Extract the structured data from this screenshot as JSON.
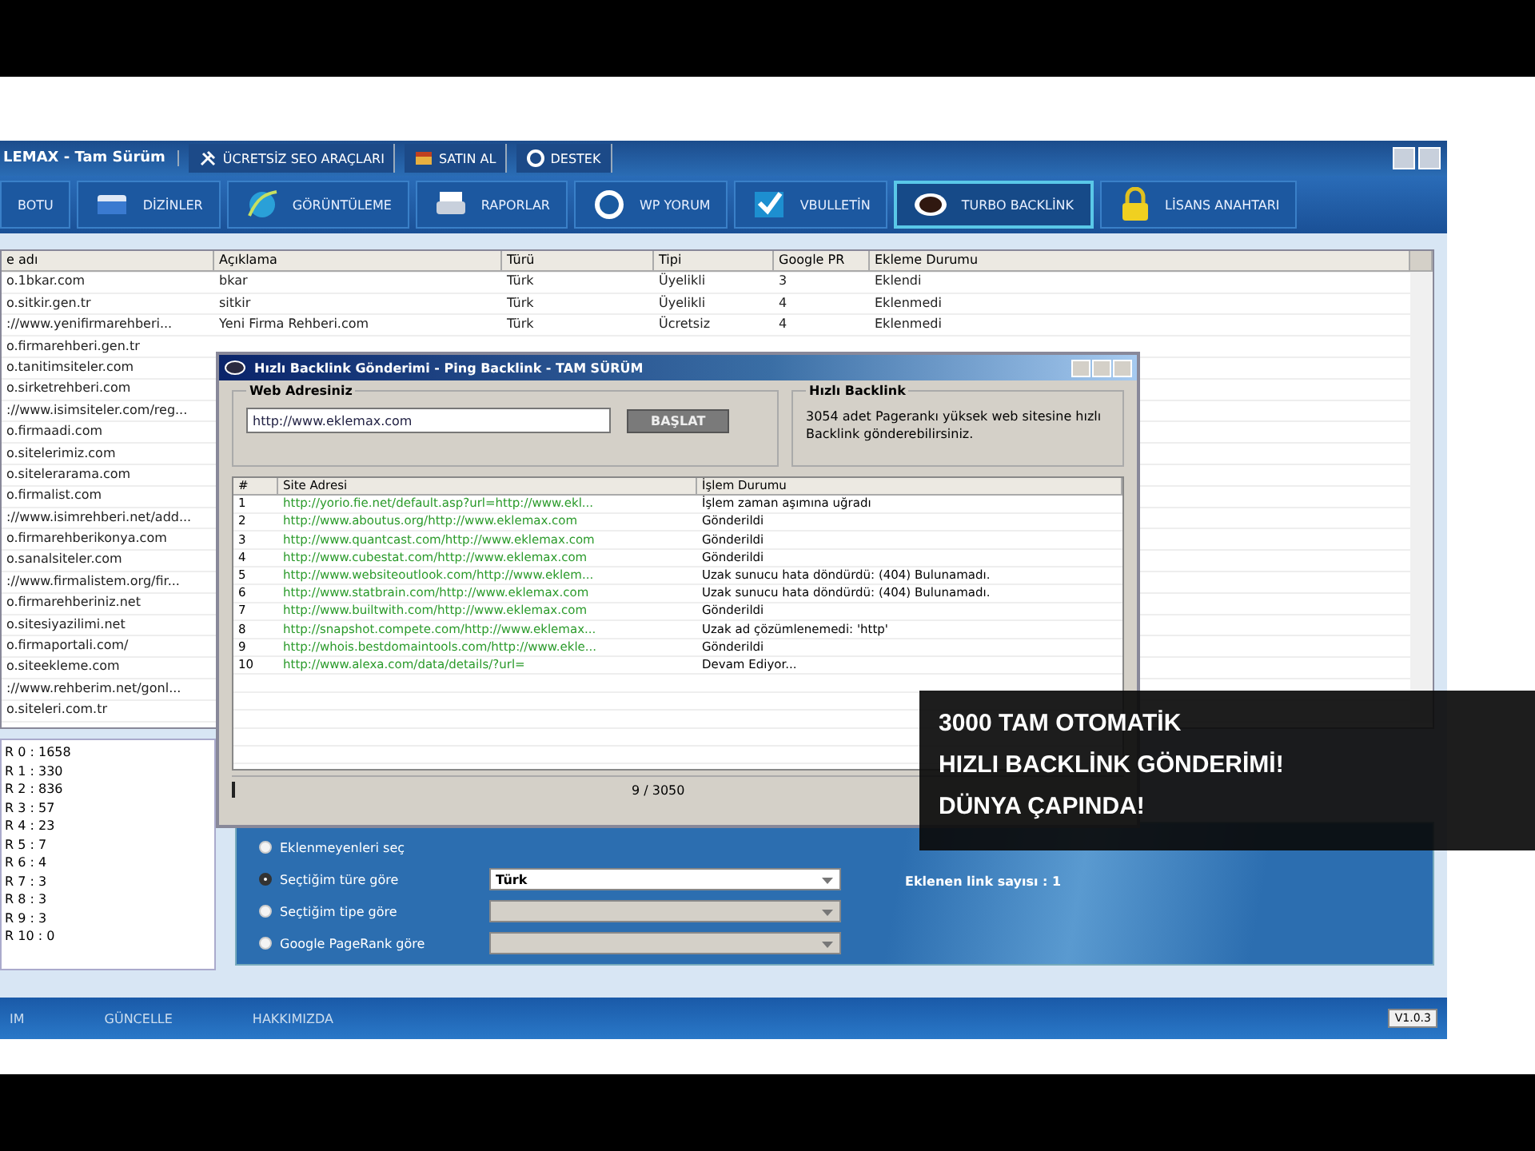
{
  "window": {
    "title": "LEMAX - Tam Sürüm",
    "menu": [
      "ÜCRETSİZ SEO ARAÇLARI",
      "SATIN AL",
      "DESTEK"
    ]
  },
  "toolbar": [
    {
      "label": "BOTU",
      "selected": false
    },
    {
      "label": "DİZİNLER",
      "selected": false
    },
    {
      "label": "GÖRÜNTÜLEME",
      "selected": false
    },
    {
      "label": "RAPORLAR",
      "selected": false
    },
    {
      "label": "WP YORUM",
      "selected": false
    },
    {
      "label": "VBULLETİN",
      "selected": false
    },
    {
      "label": "TURBO BACKLİNK",
      "selected": true
    },
    {
      "label": "LİSANS ANAHTARI",
      "selected": false
    }
  ],
  "table": {
    "columns": [
      "e adı",
      "Açıklama",
      "Türü",
      "Tipi",
      "Google PR",
      "Ekleme Durumu"
    ],
    "rows": [
      [
        "o.1bkar.com",
        "bkar",
        "Türk",
        "Üyelikli",
        "3",
        "Eklendi"
      ],
      [
        "o.sitkir.gen.tr",
        "sitkir",
        "Türk",
        "Üyelikli",
        "4",
        "Eklenmedi"
      ],
      [
        "://www.yenifirmarehberi...",
        "Yeni Firma Rehberi.com",
        "Türk",
        "Ücretsiz",
        "4",
        "Eklenmedi"
      ],
      [
        "o.firmarehberi.gen.tr"
      ],
      [
        "o.tanitimsiteler.com"
      ],
      [
        "o.sirketrehberi.com"
      ],
      [
        "://www.isimsiteler.com/reg..."
      ],
      [
        "o.firmaadi.com"
      ],
      [
        "o.sitelerimiz.com"
      ],
      [
        "o.sitelerarama.com"
      ],
      [
        "o.firmalist.com"
      ],
      [
        "://www.isimrehberi.net/add..."
      ],
      [
        "o.firmarehberikonya.com"
      ],
      [
        "o.sanalsiteler.com"
      ],
      [
        "://www.firmalistem.org/fir..."
      ],
      [
        "o.firmarehberiniz.net"
      ],
      [
        "o.sitesiyazilimi.net"
      ],
      [
        "o.firmaportali.com/"
      ],
      [
        "o.siteekleme.com"
      ],
      [
        "://www.rehberim.net/gonl..."
      ],
      [
        "o.siteleri.com.tr"
      ]
    ]
  },
  "pr_list": [
    "R 0 : 1658",
    "R 1 : 330",
    "R 2 : 836",
    "R 3 : 57",
    "R 4 : 23",
    "R 5 : 7",
    "R 6 : 4",
    "R 7 : 3",
    "R 8 : 3",
    "R 9 : 3",
    "R 10 : 0"
  ],
  "dialog": {
    "title": "Hızlı Backlink Gönderimi - Ping Backlink - TAM SÜRÜM",
    "group_label": "Web Adresiniz",
    "url_value": "http://www.eklemax.com",
    "start_button": "BAŞLAT",
    "info_title": "Hızlı Backlink",
    "info_text": "3054 adet Pagerankı yüksek web sitesine hızlı Backlink gönderebilirsiniz.",
    "columns": [
      "#",
      "Site Adresi",
      "İşlem Durumu"
    ],
    "rows": [
      [
        "1",
        "http://yorio.fie.net/default.asp?url=http://www.ekl...",
        "İşlem zaman aşımına uğradı"
      ],
      [
        "2",
        "http://www.aboutus.org/http://www.eklemax.com",
        "Gönderildi"
      ],
      [
        "3",
        "http://www.quantcast.com/http://www.eklemax.com",
        "Gönderildi"
      ],
      [
        "4",
        "http://www.cubestat.com/http://www.eklemax.com",
        "Gönderildi"
      ],
      [
        "5",
        "http://www.websiteoutlook.com/http://www.eklem...",
        "Uzak sunucu hata döndürdü: (404) Bulunamadı."
      ],
      [
        "6",
        "http://www.statbrain.com/http://www.eklemax.com",
        "Uzak sunucu hata döndürdü: (404) Bulunamadı."
      ],
      [
        "7",
        "http://www.builtwith.com/http://www.eklemax.com",
        "Gönderildi"
      ],
      [
        "8",
        "http://snapshot.compete.com/http://www.eklemax...",
        "Uzak ad çözümlenemedi: 'http'"
      ],
      [
        "9",
        "http://whois.bestdomaintools.com/http://www.ekle...",
        "Gönderildi"
      ],
      [
        "10",
        "http://www.alexa.com/data/details/?url=",
        "Devam Ediyor..."
      ]
    ],
    "progress": {
      "level": 0.003
    },
    "counter": "9 / 3050"
  },
  "options": [
    {
      "label": "Eklenmeyenleri seç",
      "selected": false
    },
    {
      "label": "Seçtiğim türe göre",
      "selected": true
    },
    {
      "label": "Seçtiğim tipe göre",
      "selected": false
    },
    {
      "label": "Google PageRank göre",
      "selected": false
    }
  ],
  "dropdowns": [
    {
      "value": "Türk",
      "disabled": false
    },
    {
      "disabled": true
    },
    {
      "disabled": true
    }
  ],
  "added_count": "Eklenen link sayısı : 1",
  "footer": {
    "links": [
      "IM",
      "GÜNCELLE",
      "HAKKIMIZDA"
    ],
    "version": "V1.0.3"
  },
  "caption": [
    "3000 TAM OTOMATİK",
    "HIZLI BACKLİNK GÖNDERİMİ!",
    "DÜNYA ÇAPINDA!"
  ]
}
